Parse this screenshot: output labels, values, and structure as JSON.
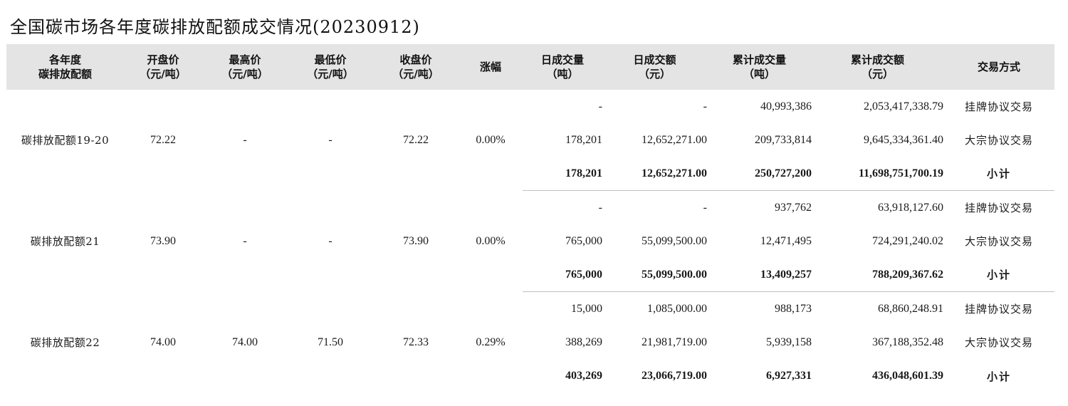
{
  "page": {
    "title": "全国碳市场各年度碳排放配额成交情况(20230912)"
  },
  "table": {
    "headers": [
      [
        "各年度",
        "碳排放配额"
      ],
      [
        "开盘价",
        "（元/吨）"
      ],
      [
        "最高价",
        "（元/吨）"
      ],
      [
        "最低价",
        "（元/吨）"
      ],
      [
        "收盘价",
        "（元/吨）"
      ],
      [
        "涨幅"
      ],
      [
        "日成交量",
        "（吨）"
      ],
      [
        "日成交额",
        "（元）"
      ],
      [
        "累计成交量",
        "（吨）"
      ],
      [
        "累计成交额",
        "（元）"
      ],
      [
        "交易方式"
      ]
    ],
    "groups": [
      {
        "allowance": "碳排放配额19-20",
        "open": "72.22",
        "high": "-",
        "low": "-",
        "close": "72.22",
        "change": "0.00%",
        "rows": [
          {
            "daily_volume": "-",
            "daily_amount": "-",
            "cum_volume": "40,993,386",
            "cum_amount": "2,053,417,338.79",
            "method": "挂牌协议交易"
          },
          {
            "daily_volume": "178,201",
            "daily_amount": "12,652,271.00",
            "cum_volume": "209,733,814",
            "cum_amount": "9,645,334,361.40",
            "method": "大宗协议交易"
          },
          {
            "daily_volume": "178,201",
            "daily_amount": "12,652,271.00",
            "cum_volume": "250,727,200",
            "cum_amount": "11,698,751,700.19",
            "method": "小计"
          }
        ]
      },
      {
        "allowance": "碳排放配额21",
        "open": "73.90",
        "high": "-",
        "low": "-",
        "close": "73.90",
        "change": "0.00%",
        "rows": [
          {
            "daily_volume": "-",
            "daily_amount": "-",
            "cum_volume": "937,762",
            "cum_amount": "63,918,127.60",
            "method": "挂牌协议交易"
          },
          {
            "daily_volume": "765,000",
            "daily_amount": "55,099,500.00",
            "cum_volume": "12,471,495",
            "cum_amount": "724,291,240.02",
            "method": "大宗协议交易"
          },
          {
            "daily_volume": "765,000",
            "daily_amount": "55,099,500.00",
            "cum_volume": "13,409,257",
            "cum_amount": "788,209,367.62",
            "method": "小计"
          }
        ]
      },
      {
        "allowance": "碳排放配额22",
        "open": "74.00",
        "high": "74.00",
        "low": "71.50",
        "close": "72.33",
        "change": "0.29%",
        "rows": [
          {
            "daily_volume": "15,000",
            "daily_amount": "1,085,000.00",
            "cum_volume": "988,173",
            "cum_amount": "68,860,248.91",
            "method": "挂牌协议交易"
          },
          {
            "daily_volume": "388,269",
            "daily_amount": "21,981,719.00",
            "cum_volume": "5,939,158",
            "cum_amount": "367,188,352.48",
            "method": "大宗协议交易"
          },
          {
            "daily_volume": "403,269",
            "daily_amount": "23,066,719.00",
            "cum_volume": "6,927,331",
            "cum_amount": "436,048,601.39",
            "method": "小计"
          }
        ]
      }
    ]
  }
}
